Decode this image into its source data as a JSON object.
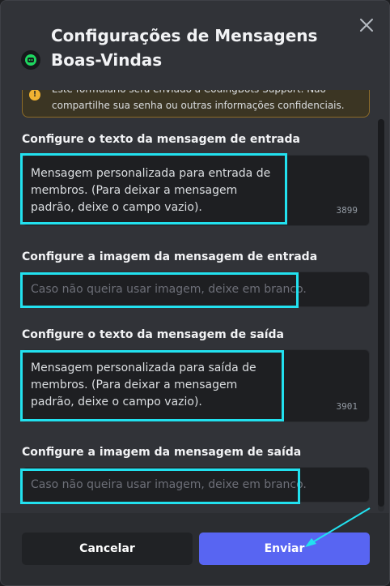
{
  "dialog": {
    "title": "Configurações de Mensagens Boas-Vindas",
    "notice": "Este formulário será enviado a CodingBots Support. Não compartilhe sua senha ou outras informações confidenciais."
  },
  "fields": [
    {
      "label": "Configure o texto da mensagem de entrada",
      "value": "Mensagem personalizada para entrada de membros. (Para deixar a mensagem padrão, deixe o campo vazio).",
      "counter": "3899"
    },
    {
      "label": "Configure a imagem da mensagem de entrada",
      "placeholder": "Caso não queira usar imagem, deixe em branco."
    },
    {
      "label": "Configure o texto da mensagem de saída",
      "value": "Mensagem personalizada para saída de membros. (Para deixar a mensagem padrão, deixe o campo vazio).",
      "counter": "3901"
    },
    {
      "label": "Configure a imagem da mensagem de saída",
      "placeholder": "Caso não queira usar imagem, deixe em branco."
    }
  ],
  "footer": {
    "cancel_label": "Cancelar",
    "submit_label": "Enviar"
  },
  "colors": {
    "background": "#313338",
    "accent": "#5865f2",
    "highlight": "#22e1ef",
    "warning": "#f0b232"
  },
  "icons": [
    "app-icon",
    "close-icon",
    "warning-icon"
  ]
}
